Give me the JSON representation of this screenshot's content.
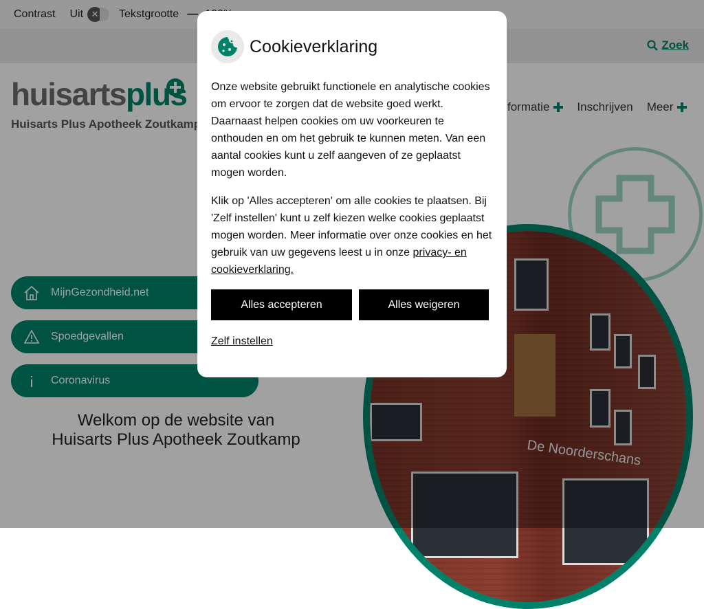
{
  "colors": {
    "brand": "#00826a",
    "overlay": "rgba(0,0,0,0.37)",
    "button": "#000000"
  },
  "topbar": {
    "contrast_label": "Contrast",
    "contrast_value": "Uit",
    "text_size_label": "Tekstgrootte",
    "minus_label": "—",
    "text_size_value": "100%"
  },
  "search": {
    "label": "Zoek",
    "icon": "search-icon"
  },
  "logo": {
    "word_gray": "huisarts",
    "word_green": "plus",
    "subtitle": "Huisarts Plus Apotheek Zoutkamp"
  },
  "nav": {
    "items": [
      {
        "label": "formatie",
        "has_plus": true
      },
      {
        "label": "Inschrijven",
        "has_plus": false
      },
      {
        "label": "Meer",
        "has_plus": true
      }
    ]
  },
  "quicklinks": [
    {
      "label": "MijnGezondheid.net",
      "icon": "home-icon"
    },
    {
      "label": "Spoedgevallen",
      "icon": "warning-icon"
    },
    {
      "label": "Coronavirus",
      "icon": "info-icon"
    }
  ],
  "welcome": {
    "line1": "Welkom op de website van",
    "line2": "Huisarts Plus Apotheek Zoutkamp"
  },
  "photo": {
    "sign_text": "De Noorderschans"
  },
  "cookie_modal": {
    "title": "Cookieverklaring",
    "icon": "cookie-icon",
    "paragraph1": "Onze website gebruikt functionele en analytische cookies om ervoor te zorgen dat de website goed werkt. Daarnaast helpen cookies om uw voorkeuren te onthouden en om het gebruik te kunnen meten. Van een aantal cookies kunt u zelf aangeven of ze geplaatst mogen worden.",
    "paragraph2_text": "Klik op 'Alles accepteren' om alle cookies te plaatsen. Bij 'Zelf instellen' kunt u zelf kiezen welke cookies geplaatst mogen worden. Meer informatie over onze cookies en het gebruik van uw gegevens leest u in onze ",
    "paragraph2_link": "privacy- en cookieverklaring.",
    "accept_label": "Alles accepteren",
    "reject_label": "Alles weigeren",
    "custom_label": "Zelf instellen"
  }
}
